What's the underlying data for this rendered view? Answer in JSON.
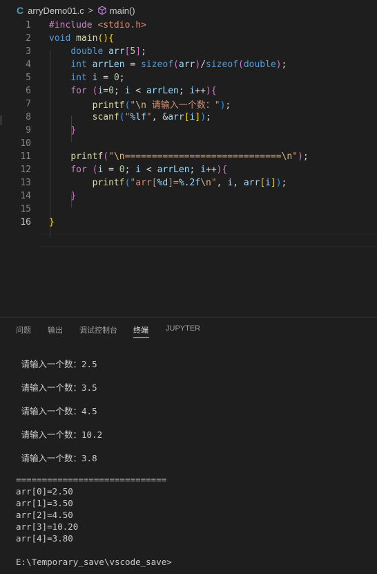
{
  "breadcrumb": {
    "lang_icon": "C",
    "file": "arryDemo01.c",
    "sep": ">",
    "symbol": "main()"
  },
  "code_lines": [
    {
      "n": "1"
    },
    {
      "n": "2"
    },
    {
      "n": "3"
    },
    {
      "n": "4"
    },
    {
      "n": "5"
    },
    {
      "n": "6"
    },
    {
      "n": "7"
    },
    {
      "n": "8"
    },
    {
      "n": "9"
    },
    {
      "n": "10"
    },
    {
      "n": "11"
    },
    {
      "n": "12"
    },
    {
      "n": "13"
    },
    {
      "n": "14"
    },
    {
      "n": "15"
    },
    {
      "n": "16"
    }
  ],
  "code_text": [
    "#include <stdio.h>",
    "void main(){",
    "double arr[5];",
    "int arrLen = sizeof(arr)/sizeof(double);",
    "int i = 0;",
    "for (i=0; i < arrLen; i++){",
    "printf(\"\\n 请输入一个数：\");",
    "scanf(\"%lf\", &arr[i]);",
    "}",
    "",
    "printf(\"\\n=============================\\n\");",
    "for (i = 0; i < arrLen; i++){",
    "printf(\"arr[%d]=%.2f\\n\", i, arr[i]);",
    "}",
    "",
    "}"
  ],
  "panel_tabs": [
    "问题",
    "输出",
    "调试控制台",
    "终端",
    "JUPYTER"
  ],
  "active_tab": "终端",
  "terminal_lines": [
    " 请输入一个数：2.5",
    " 请输入一个数：3.5",
    " 请输入一个数：4.5",
    " 请输入一个数：10.2",
    " 请输入一个数：3.8",
    "=============================",
    "arr[0]=2.50",
    "arr[1]=3.50",
    "arr[2]=4.50",
    "arr[3]=10.20",
    "arr[4]=3.80",
    "E:\\Temporary_save\\vscode_save>"
  ]
}
